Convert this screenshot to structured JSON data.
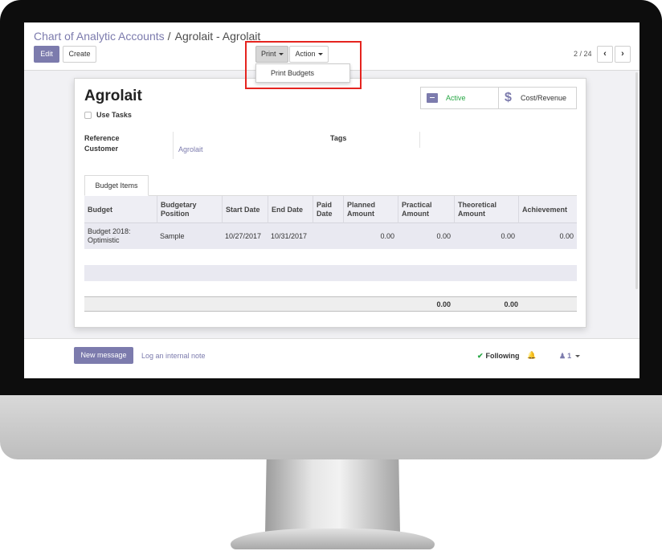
{
  "breadcrumb": {
    "parent": "Chart of Analytic Accounts",
    "separator": "/",
    "current": "Agrolait - Agrolait"
  },
  "buttons": {
    "edit": "Edit",
    "create": "Create",
    "print": "Print",
    "action": "Action"
  },
  "print_menu": {
    "items": [
      "Print Budgets"
    ]
  },
  "pager": {
    "value": "2 / 24",
    "prev": "‹",
    "next": "›"
  },
  "record": {
    "name": "Agrolait",
    "use_tasks_label": "Use Tasks",
    "use_tasks_checked": false,
    "reference_label": "Reference",
    "customer_label": "Customer",
    "customer_value": "Agrolait",
    "tags_label": "Tags"
  },
  "smart_buttons": {
    "active": "Active",
    "cost_revenue": "Cost/Revenue"
  },
  "notebook": {
    "tab": "Budget Items"
  },
  "budget_table": {
    "headers": [
      "Budget",
      "Budgetary Position",
      "Start Date",
      "End Date",
      "Paid Date",
      "Planned Amount",
      "Practical Amount",
      "Theoretical Amount",
      "Achievement"
    ],
    "rows": [
      {
        "budget": "Budget 2018: Optimistic",
        "position": "Sample",
        "start": "10/27/2017",
        "end": "10/31/2017",
        "paid": "",
        "planned": "0.00",
        "practical": "0.00",
        "theoretical": "0.00",
        "achievement": "0.00"
      }
    ],
    "totals": {
      "practical": "0.00",
      "theoretical": "0.00"
    }
  },
  "chatter": {
    "new_message": "New message",
    "log_note": "Log an internal note",
    "following": "Following",
    "followers_count": "1"
  },
  "colors": {
    "brand": "#7c7bad",
    "highlight": "#e5241f",
    "success": "#28a745"
  }
}
